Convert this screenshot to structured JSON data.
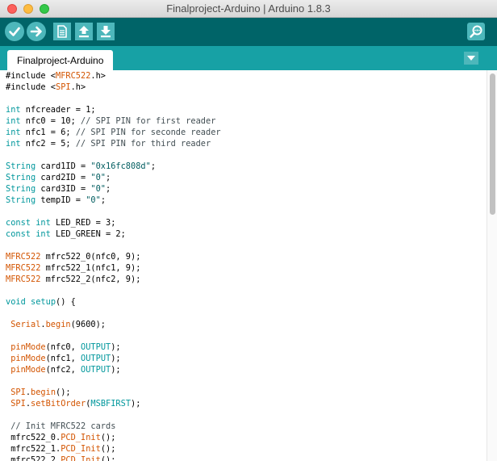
{
  "window": {
    "title": "Finalproject-Arduino | Arduino 1.8.3"
  },
  "toolbar": {
    "buttons": [
      "verify-icon",
      "upload-icon",
      "new-icon",
      "open-icon",
      "save-icon",
      "serial-monitor-icon"
    ]
  },
  "tabs": [
    {
      "label": "Finalproject-Arduino"
    }
  ],
  "colors": {
    "toolbar": "#006468",
    "tabstrip": "#17a1a5",
    "button": "#4db7bb",
    "keyword": "#00979c",
    "library": "#d35400",
    "string": "#005c5f"
  },
  "code": {
    "lines": [
      [
        [
          "#include <",
          ""
        ],
        [
          "MFRC522",
          "lib"
        ],
        [
          ".h>",
          ""
        ]
      ],
      [
        [
          "#include <",
          ""
        ],
        [
          "SPI",
          "lib"
        ],
        [
          ".h>",
          ""
        ]
      ],
      [],
      [
        [
          "int",
          "kw"
        ],
        [
          " nfcreader = 1;",
          ""
        ]
      ],
      [
        [
          "int",
          "kw"
        ],
        [
          " nfc0 = 10; ",
          ""
        ],
        [
          "// SPI PIN for first reader",
          "com"
        ]
      ],
      [
        [
          "int",
          "kw"
        ],
        [
          " nfc1 = 6; ",
          ""
        ],
        [
          "// SPI PIN for seconde reader",
          "com"
        ]
      ],
      [
        [
          "int",
          "kw"
        ],
        [
          " nfc2 = 5; ",
          ""
        ],
        [
          "// SPI PIN for third reader",
          "com"
        ]
      ],
      [],
      [
        [
          "String",
          "kw"
        ],
        [
          " card1ID = ",
          ""
        ],
        [
          "\"0x16fc808d\"",
          "str"
        ],
        [
          ";",
          ""
        ]
      ],
      [
        [
          "String",
          "kw"
        ],
        [
          " card2ID = ",
          ""
        ],
        [
          "\"0\"",
          "str"
        ],
        [
          ";",
          ""
        ]
      ],
      [
        [
          "String",
          "kw"
        ],
        [
          " card3ID = ",
          ""
        ],
        [
          "\"0\"",
          "str"
        ],
        [
          ";",
          ""
        ]
      ],
      [
        [
          "String",
          "kw"
        ],
        [
          " tempID = ",
          ""
        ],
        [
          "\"0\"",
          "str"
        ],
        [
          ";",
          ""
        ]
      ],
      [],
      [
        [
          "const",
          "kw"
        ],
        [
          " ",
          ""
        ],
        [
          "int",
          "kw"
        ],
        [
          " LED_RED = 3;",
          ""
        ]
      ],
      [
        [
          "const",
          "kw"
        ],
        [
          " ",
          ""
        ],
        [
          "int",
          "kw"
        ],
        [
          " LED_GREEN = 2;",
          ""
        ]
      ],
      [],
      [
        [
          "MFRC522",
          "lib"
        ],
        [
          " mfrc522_0(nfc0, 9);",
          ""
        ]
      ],
      [
        [
          "MFRC522",
          "lib"
        ],
        [
          " mfrc522_1(nfc1, 9);",
          ""
        ]
      ],
      [
        [
          "MFRC522",
          "lib"
        ],
        [
          " mfrc522_2(nfc2, 9);",
          ""
        ]
      ],
      [],
      [
        [
          "void",
          "kw"
        ],
        [
          " ",
          ""
        ],
        [
          "setup",
          "kw"
        ],
        [
          "() {",
          ""
        ]
      ],
      [],
      [
        [
          " ",
          ""
        ],
        [
          "Serial",
          "fn"
        ],
        [
          ".",
          ""
        ],
        [
          "begin",
          "fn"
        ],
        [
          "(9600);",
          ""
        ]
      ],
      [],
      [
        [
          " ",
          ""
        ],
        [
          "pinMode",
          "fn"
        ],
        [
          "(nfc0, ",
          ""
        ],
        [
          "OUTPUT",
          "kw"
        ],
        [
          ");",
          ""
        ]
      ],
      [
        [
          " ",
          ""
        ],
        [
          "pinMode",
          "fn"
        ],
        [
          "(nfc1, ",
          ""
        ],
        [
          "OUTPUT",
          "kw"
        ],
        [
          ");",
          ""
        ]
      ],
      [
        [
          " ",
          ""
        ],
        [
          "pinMode",
          "fn"
        ],
        [
          "(nfc2, ",
          ""
        ],
        [
          "OUTPUT",
          "kw"
        ],
        [
          ");",
          ""
        ]
      ],
      [],
      [
        [
          " ",
          ""
        ],
        [
          "SPI",
          "fn"
        ],
        [
          ".",
          ""
        ],
        [
          "begin",
          "fn"
        ],
        [
          "();",
          ""
        ]
      ],
      [
        [
          " ",
          ""
        ],
        [
          "SPI",
          "fn"
        ],
        [
          ".",
          ""
        ],
        [
          "setBitOrder",
          "fn"
        ],
        [
          "(",
          ""
        ],
        [
          "MSBFIRST",
          "kw"
        ],
        [
          ");",
          ""
        ]
      ],
      [],
      [
        [
          " ",
          ""
        ],
        [
          "// Init MFRC522 cards",
          "com"
        ]
      ],
      [
        [
          " mfrc522_0.",
          ""
        ],
        [
          "PCD_Init",
          "fn"
        ],
        [
          "();",
          ""
        ]
      ],
      [
        [
          " mfrc522_1.",
          ""
        ],
        [
          "PCD_Init",
          "fn"
        ],
        [
          "();",
          ""
        ]
      ],
      [
        [
          " mfrc522_2.",
          ""
        ],
        [
          "PCD_Init",
          "fn"
        ],
        [
          "();",
          ""
        ]
      ]
    ]
  }
}
